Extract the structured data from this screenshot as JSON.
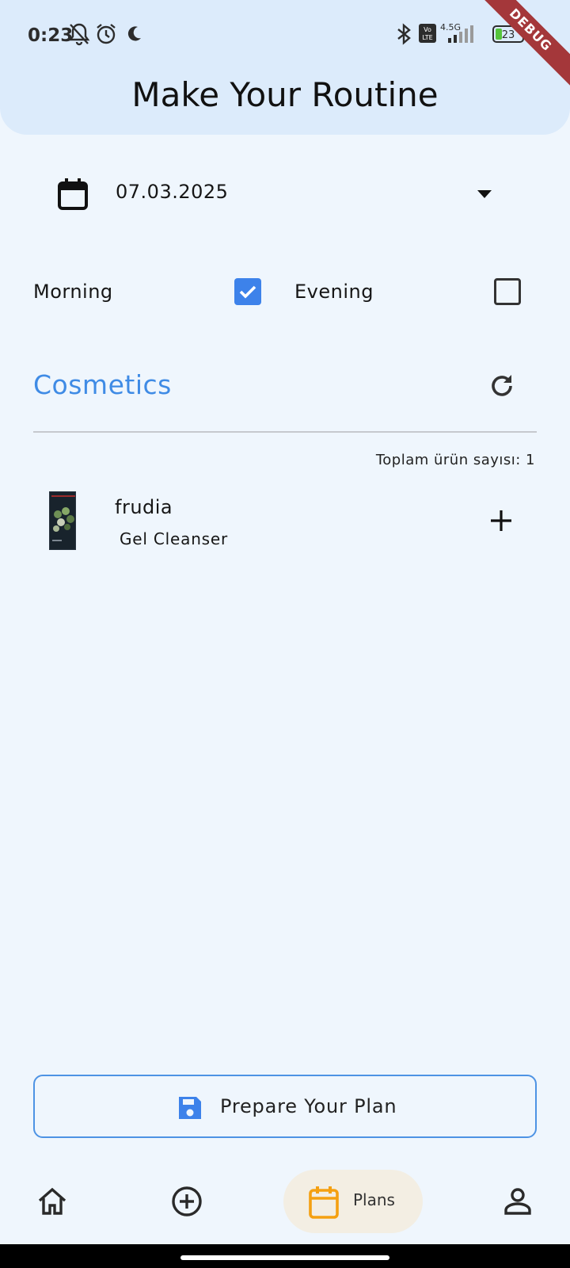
{
  "status_bar": {
    "time": "0:23",
    "network": "4.5G",
    "volte": "Vo LTE",
    "battery": "23"
  },
  "debug_banner": "DEBUG",
  "header": {
    "title": "Make Your Routine"
  },
  "date_picker": {
    "value": "07.03.2025"
  },
  "sessions": {
    "morning": {
      "label": "Morning",
      "checked": true
    },
    "evening": {
      "label": "Evening",
      "checked": false
    }
  },
  "cosmetics": {
    "title": "Cosmetics",
    "count_text": "Toplam ürün sayısı: 1",
    "products": [
      {
        "brand": "frudia",
        "name": "Gel Cleanser"
      }
    ]
  },
  "prepare_button": {
    "label": "Prepare Your Plan"
  },
  "bottom_nav": {
    "items": [
      {
        "icon": "home-icon"
      },
      {
        "icon": "add-circle-icon"
      },
      {
        "icon": "calendar-icon",
        "label": "Plans",
        "selected": true
      },
      {
        "icon": "person-icon"
      }
    ]
  },
  "colors": {
    "accent_blue": "#3f8be5",
    "checkbox_blue": "#3d82ea",
    "nav_selected_bg": "#f3eee3",
    "nav_selected_icon": "#f5a011",
    "header_bg": "#dcebfb",
    "page_bg": "#eff6fd"
  }
}
